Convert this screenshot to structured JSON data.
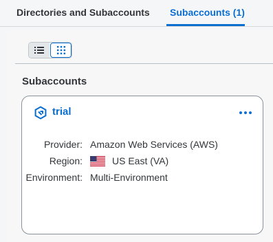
{
  "tabs": [
    {
      "label": "Directories and Subaccounts",
      "selected": false
    },
    {
      "label": "Subaccounts (1)",
      "selected": true
    }
  ],
  "view_toggle": {
    "options": [
      {
        "icon": "list-icon",
        "selected": true
      },
      {
        "icon": "grid-icon",
        "selected": false
      }
    ]
  },
  "section": {
    "title": "Subaccounts"
  },
  "card": {
    "title": "trial",
    "icon": "subaccount-icon",
    "menu_icon": "more-options-icon",
    "fields": {
      "provider_label": "Provider:",
      "provider_value": "Amazon Web Services (AWS)",
      "region_label": "Region:",
      "region_value": "US East (VA)",
      "region_flag": "us-flag-icon",
      "environment_label": "Environment:",
      "environment_value": "Multi-Environment"
    }
  },
  "colors": {
    "accent": "#0a6ed1",
    "text": "#32363a",
    "background": "#f5f6f7",
    "card_border": "#89919a"
  }
}
